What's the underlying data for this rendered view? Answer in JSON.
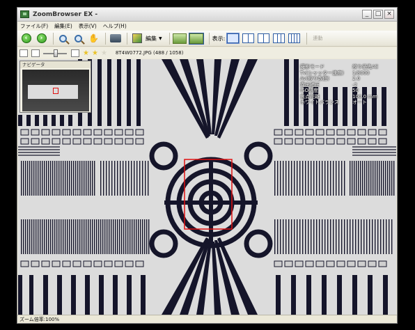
{
  "window": {
    "title": "ZoomBrowser EX -",
    "min_glyph": "_",
    "max_glyph": "□",
    "close_glyph": "×"
  },
  "menu": [
    "ファイル(F)",
    "編集(E)",
    "表示(V)",
    "ヘルプ(H)"
  ],
  "toolbar": {
    "edit_label": "編集",
    "display_label": "表示:",
    "link_label": "連動"
  },
  "toolbar2": {
    "zoom_level_fraction": 0.55,
    "rating_filled": 2,
    "rating_total": 3,
    "file_info": "8T4W0772.JPG (488 / 1058)"
  },
  "navigator": {
    "title": "ナビゲータ"
  },
  "shooting_info": [
    {
      "key": "撮影モード",
      "value": "絞り優先AE"
    },
    {
      "key": "Tv(シャッター速度)",
      "value": "1/8000"
    },
    {
      "key": "Av(絞り数値)",
      "value": "2.0"
    },
    {
      "key": "露出補正",
      "value": "-2"
    },
    {
      "key": "ISO感度",
      "value": "50"
    },
    {
      "key": "焦点距離",
      "value": "100.0 mm"
    },
    {
      "key": "ホワイトバランス",
      "value": "オート"
    }
  ],
  "status": {
    "zoom_text": "ズーム倍率:100%"
  },
  "colors": {
    "selection": "#e01010",
    "chart_ink": "#15152a",
    "chart_paper": "#dcdcdc"
  }
}
